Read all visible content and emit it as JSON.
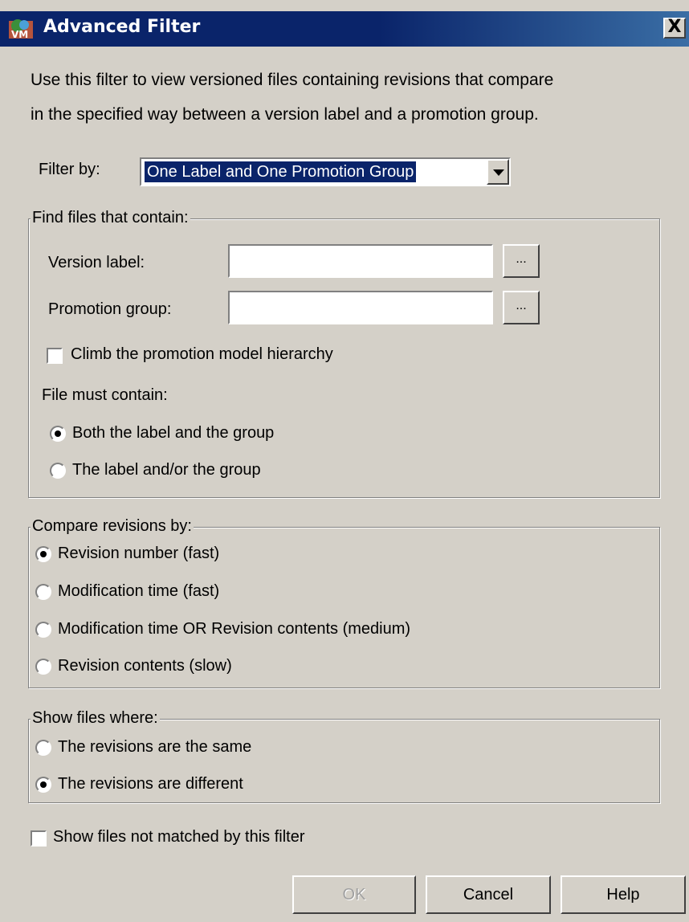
{
  "window": {
    "title": "Advanced Filter",
    "close_label": "X"
  },
  "intro": {
    "line1": "Use this filter to view versioned files containing revisions that compare",
    "line2": "in the specified way between a version label and a promotion group."
  },
  "filter_by": {
    "label": "Filter by:",
    "value": "One Label and One Promotion Group"
  },
  "find_files": {
    "legend": "Find files that contain:",
    "version_label": {
      "label": "Version label:",
      "value": "",
      "browse": "..."
    },
    "promotion_group": {
      "label": "Promotion group:",
      "value": "",
      "browse": "..."
    },
    "climb": {
      "label": "Climb the promotion model hierarchy",
      "checked": false
    },
    "must_contain_label": "File must contain:",
    "options": [
      {
        "label": "Both the label and the group",
        "selected": true
      },
      {
        "label": "The label and/or the group",
        "selected": false
      }
    ]
  },
  "compare": {
    "legend": "Compare revisions by:",
    "options": [
      {
        "label": "Revision number (fast)",
        "selected": true
      },
      {
        "label": "Modification time (fast)",
        "selected": false
      },
      {
        "label": "Modification time OR Revision contents (medium)",
        "selected": false
      },
      {
        "label": "Revision contents (slow)",
        "selected": false
      }
    ]
  },
  "show_files": {
    "legend": "Show files where:",
    "options": [
      {
        "label": "The revisions are the same",
        "selected": false
      },
      {
        "label": "The revisions are different",
        "selected": true
      }
    ]
  },
  "show_unmatched": {
    "label": "Show files not matched by this filter",
    "checked": false
  },
  "buttons": {
    "ok": "OK",
    "cancel": "Cancel",
    "help": "Help"
  }
}
